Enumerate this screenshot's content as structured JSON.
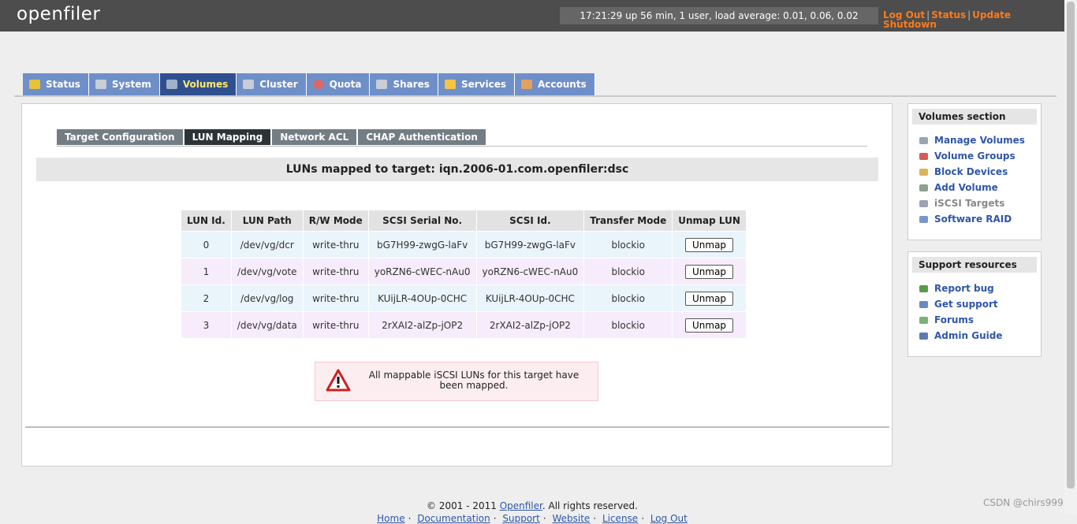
{
  "header": {
    "logo": "openfiler",
    "uptime": "17:21:29 up 56 min, 1 user, load average: 0.01, 0.06, 0.02",
    "links": [
      "Log Out",
      "Status",
      "Update",
      "Shutdown"
    ]
  },
  "main_tabs": [
    {
      "label": "Status",
      "icon": "status-icon",
      "color": "#e8c23a"
    },
    {
      "label": "System",
      "icon": "system-icon",
      "color": "#c8cdd6"
    },
    {
      "label": "Volumes",
      "icon": "volumes-icon",
      "color": "#9fb2c9"
    },
    {
      "label": "Cluster",
      "icon": "cluster-icon",
      "color": "#c8cdd6"
    },
    {
      "label": "Quota",
      "icon": "quota-icon",
      "color": "#d66a6a"
    },
    {
      "label": "Shares",
      "icon": "shares-icon",
      "color": "#c8cdd6"
    },
    {
      "label": "Services",
      "icon": "services-icon",
      "color": "#f4c542"
    },
    {
      "label": "Accounts",
      "icon": "accounts-icon",
      "color": "#e0a25e"
    }
  ],
  "active_main_tab": "Volumes",
  "sub_tabs": [
    "Target Configuration",
    "LUN Mapping",
    "Network ACL",
    "CHAP Authentication"
  ],
  "active_sub_tab": "LUN Mapping",
  "page_title": "LUNs mapped to target: iqn.2006-01.com.openfiler:dsc",
  "lun_table": {
    "headers": [
      "LUN Id.",
      "LUN Path",
      "R/W Mode",
      "SCSI Serial No.",
      "SCSI Id.",
      "Transfer Mode",
      "Unmap LUN"
    ],
    "rows": [
      [
        "0",
        "/dev/vg/dcr",
        "write-thru",
        "bG7H99-zwgG-laFv",
        "bG7H99-zwgG-laFv",
        "blockio"
      ],
      [
        "1",
        "/dev/vg/vote",
        "write-thru",
        "yoRZN6-cWEC-nAu0",
        "yoRZN6-cWEC-nAu0",
        "blockio"
      ],
      [
        "2",
        "/dev/vg/log",
        "write-thru",
        "KUijLR-4OUp-0CHC",
        "KUijLR-4OUp-0CHC",
        "blockio"
      ],
      [
        "3",
        "/dev/vg/data",
        "write-thru",
        "2rXAI2-alZp-jOP2",
        "2rXAI2-alZp-jOP2",
        "blockio"
      ]
    ],
    "button_label": "Unmap"
  },
  "notice": "All mappable iSCSI LUNs for this target have been mapped.",
  "volumes_section": {
    "title": "Volumes section",
    "items": [
      {
        "label": "Manage Volumes",
        "icon": "manage-volumes-icon",
        "color": "#9aa4b0"
      },
      {
        "label": "Volume Groups",
        "icon": "volume-groups-icon",
        "color": "#d65a5a"
      },
      {
        "label": "Block Devices",
        "icon": "block-devices-icon",
        "color": "#d9b45a"
      },
      {
        "label": "Add Volume",
        "icon": "add-volume-icon",
        "color": "#8fa08f"
      },
      {
        "label": "iSCSI Targets",
        "icon": "iscsi-targets-icon",
        "color": "#9aa4b0",
        "muted": true
      },
      {
        "label": "Software RAID",
        "icon": "software-raid-icon",
        "color": "#7a96c8"
      }
    ]
  },
  "support_section": {
    "title": "Support resources",
    "items": [
      {
        "label": "Report bug",
        "icon": "report-bug-icon",
        "color": "#5a9a4a"
      },
      {
        "label": "Get support",
        "icon": "get-support-icon",
        "color": "#6a8ac0"
      },
      {
        "label": "Forums",
        "icon": "forums-icon",
        "color": "#7ab07a"
      },
      {
        "label": "Admin Guide",
        "icon": "admin-guide-icon",
        "color": "#5a7ab0"
      }
    ]
  },
  "footer": {
    "copyright_prefix": "© 2001 - 2011",
    "brand_link": "Openfiler",
    "copyright_suffix": ". All rights reserved.",
    "links": [
      "Home",
      "Documentation",
      "Support",
      "Website",
      "License",
      "Log Out"
    ]
  },
  "watermark": "CSDN @chirs999"
}
